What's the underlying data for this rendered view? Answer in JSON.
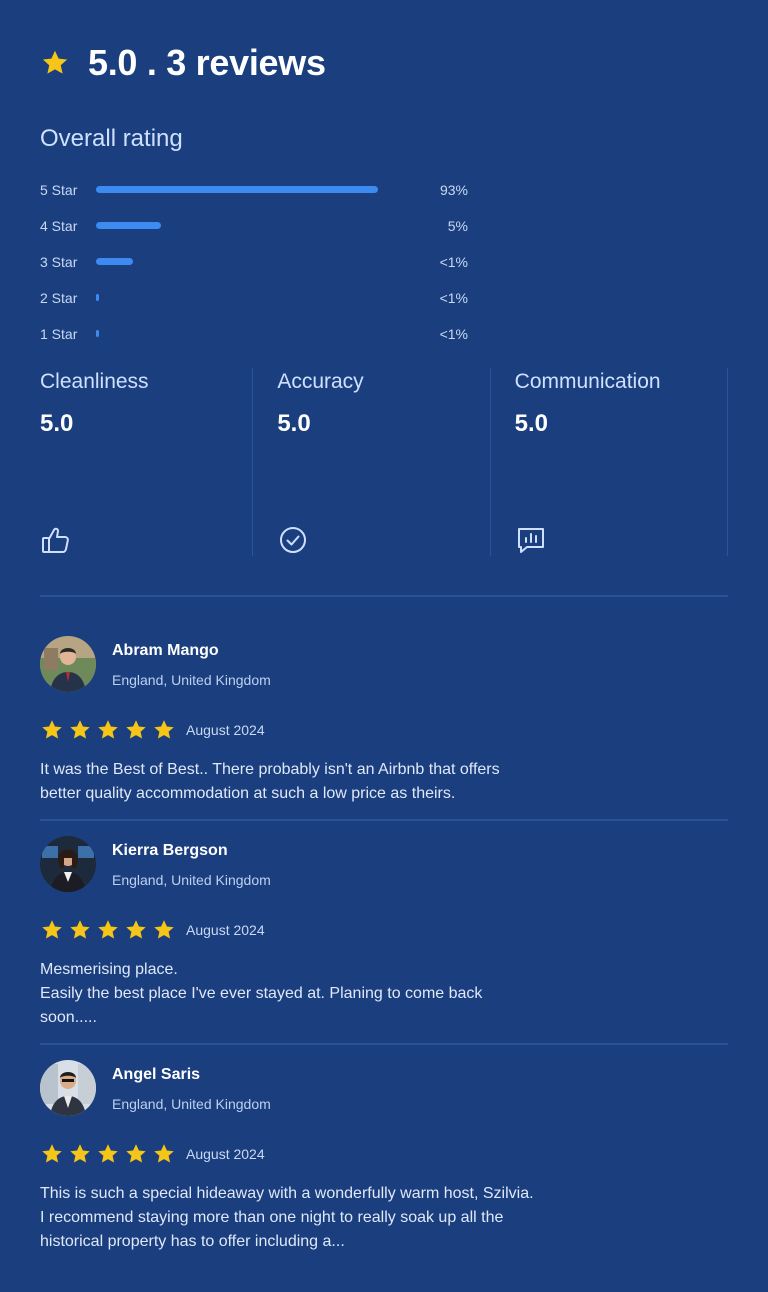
{
  "summary": {
    "title": "5.0 . 3 reviews",
    "icon": "star-icon",
    "star_color": "#f5c518"
  },
  "overall": {
    "heading": "Overall rating",
    "bars": [
      {
        "label": "5 Star",
        "percent_text": "93%",
        "fill": 1.0
      },
      {
        "label": "4 Star",
        "percent_text": "5%",
        "fill": 0.23
      },
      {
        "label": "3 Star",
        "percent_text": "<1%",
        "fill": 0.13
      },
      {
        "label": "2 Star",
        "percent_text": "<1%",
        "fill": 0.01
      },
      {
        "label": "1 Star",
        "percent_text": "<1%",
        "fill": 0.01
      }
    ],
    "bar_color": "#3d8bf0"
  },
  "categories": [
    {
      "name": "Cleanliness",
      "value": "5.0",
      "icon": "thumbs-up-icon"
    },
    {
      "name": "Accuracy",
      "value": "5.0",
      "icon": "check-circle-icon"
    },
    {
      "name": "Communication",
      "value": "5.0",
      "icon": "chat-chart-icon"
    }
  ],
  "reviews": [
    {
      "name": "Abram Mango",
      "location": "England, United Kingdom",
      "rating": 5,
      "date": "August 2024",
      "text": "It was the Best of Best.. There probably isn't an Airbnb that offers\nbetter quality accommodation at such a low price as theirs."
    },
    {
      "name": "Kierra Bergson",
      "location": "England, United Kingdom",
      "rating": 5,
      "date": "August 2024",
      "text": "Mesmerising place.\nEasily the best place I've ever stayed at. Planing to come back\nsoon....."
    },
    {
      "name": "Angel Saris",
      "location": "England, United Kingdom",
      "rating": 5,
      "date": "August 2024",
      "text": "This is such a special hideaway with a wonderfully warm host, Szilvia.\nI recommend staying more than one night to really soak up all the\nhistorical property has to offer including a..."
    }
  ]
}
